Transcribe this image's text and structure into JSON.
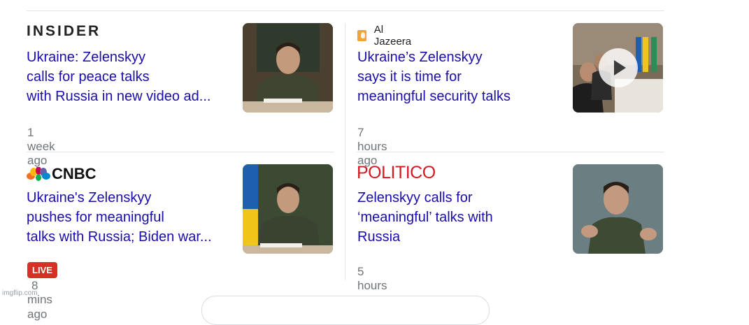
{
  "cards": [
    {
      "source": "INSIDER",
      "headline_lines": [
        "Ukraine: Zelenskyy",
        "calls for peace talks",
        "with Russia in new video ad..."
      ],
      "time": "1 week ago"
    },
    {
      "source": "Al Jazeera",
      "headline_lines": [
        "Ukraine’s Zelenskyy",
        "says it is time for",
        "meaningful security talks"
      ],
      "time": "7 hours ago"
    },
    {
      "source": "CNBC",
      "headline_lines": [
        "Ukraine's Zelenskyy",
        "pushes for meaningful",
        "talks with Russia; Biden war..."
      ],
      "badge": "LIVE",
      "time": "8 mins ago"
    },
    {
      "source": "POLITICO",
      "headline_lines": [
        "Zelenskyy calls for",
        "‘meaningful’ talks with",
        "Russia"
      ],
      "time": "5 hours ago"
    }
  ],
  "watermark": "imgflip.com",
  "colors": {
    "headline": "#1a0dab",
    "time": "#70757a",
    "live_badge": "#d93025",
    "politico": "#d71920",
    "aljazeera_icon": "#f0a23b"
  }
}
